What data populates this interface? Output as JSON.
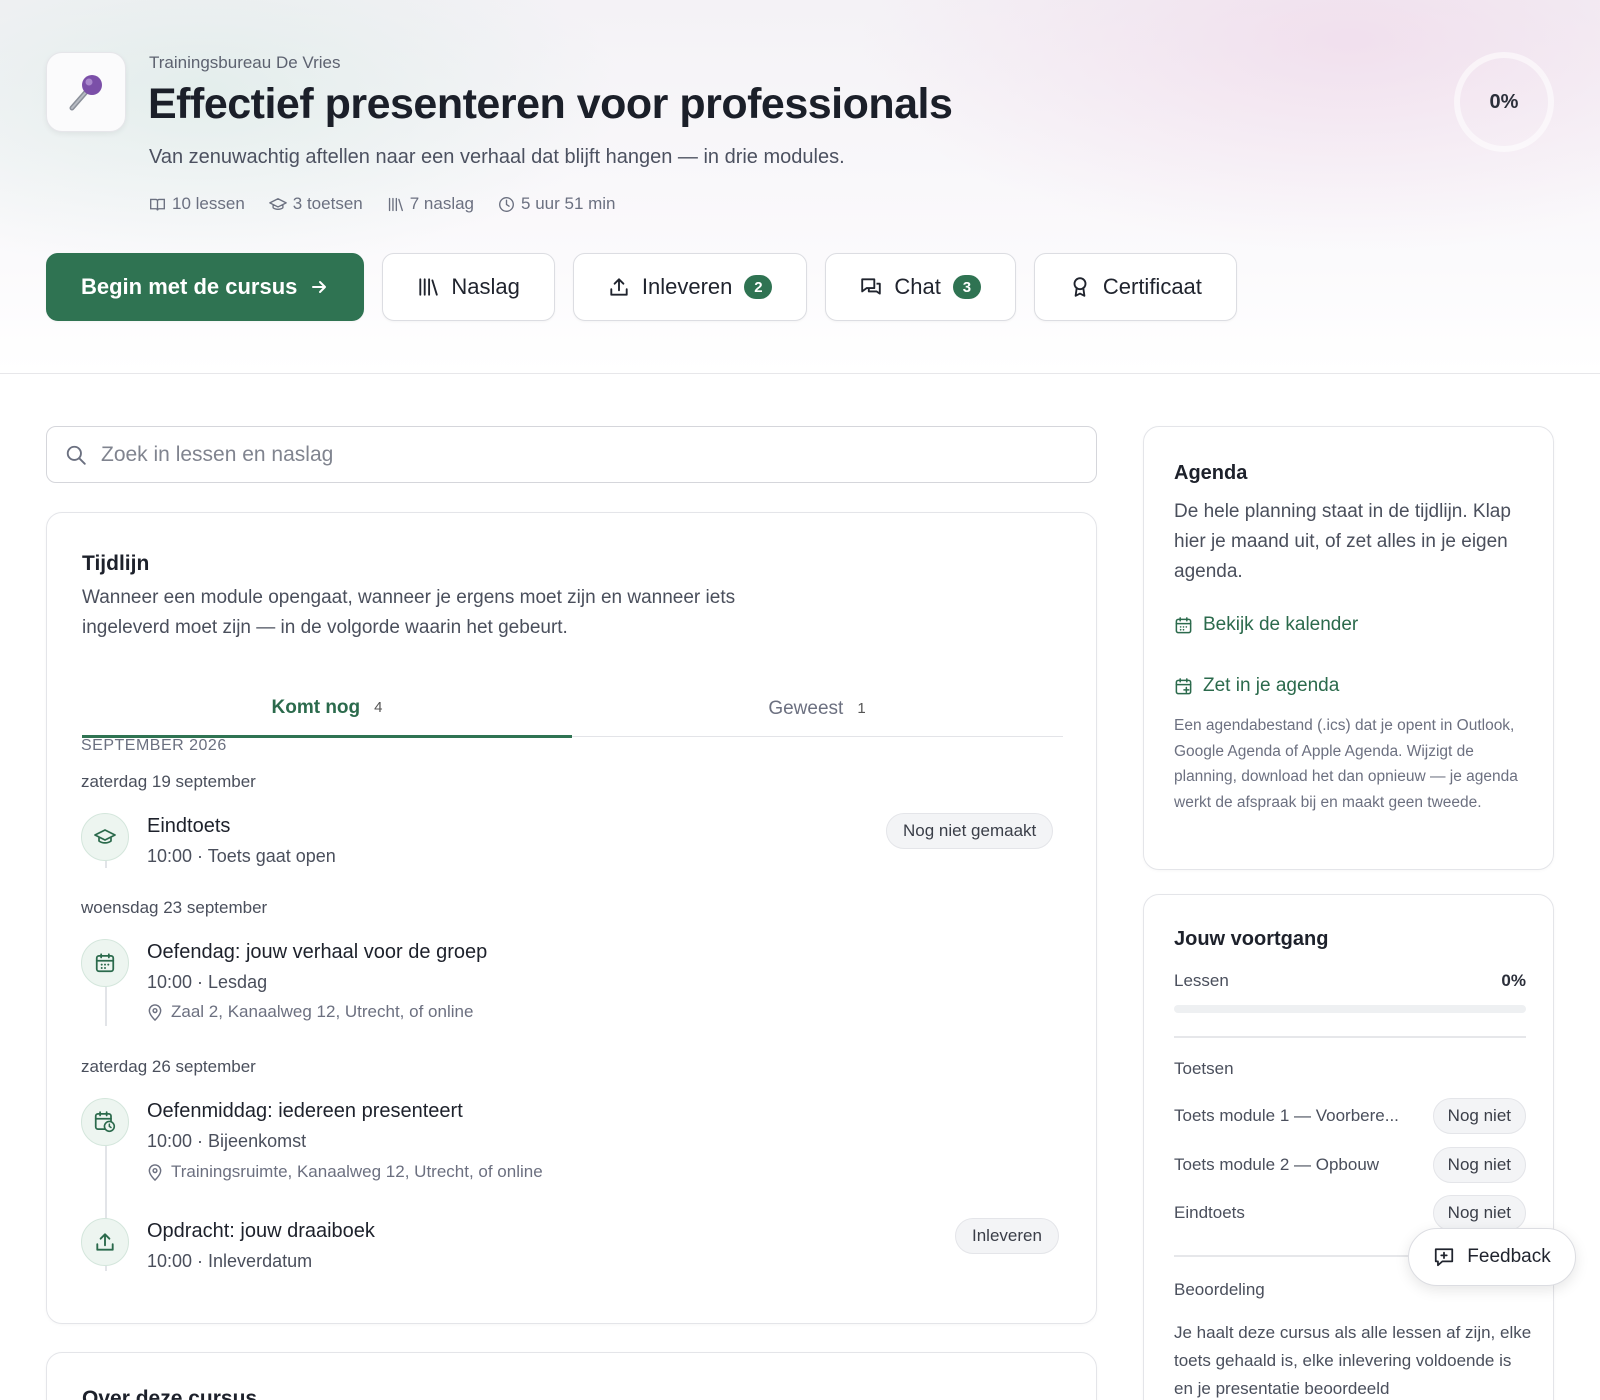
{
  "header": {
    "org": "Trainingsbureau De Vries",
    "title": "Effectief presenteren voor professionals",
    "subtitle": "Van zenuwachtig aftellen naar een verhaal dat blijft hangen — in drie modules.",
    "meta": {
      "lessons": "10 lessen",
      "tests": "3 toetsen",
      "reference": "7 naslag",
      "duration": "5 uur 51 min"
    },
    "progress": "0%",
    "progress_value": 0
  },
  "actions": {
    "start": "Begin met de cursus",
    "reference": "Naslag",
    "submit": "Inleveren",
    "submit_count": "2",
    "chat": "Chat",
    "chat_count": "3",
    "certificate": "Certificaat"
  },
  "search": {
    "placeholder": "Zoek in lessen en naslag"
  },
  "timeline": {
    "title": "Tijdlijn",
    "description": "Wanneer een module opengaat, wanneer je ergens moet zijn en wanneer iets ingeleverd moet zijn — in de volgorde waarin het gebeurt.",
    "tabs": [
      {
        "label": "Komt nog",
        "count": "4"
      },
      {
        "label": "Geweest",
        "count": "1"
      }
    ],
    "month": "SEPTEMBER 2026",
    "days": [
      {
        "label": "zaterdag 19 september",
        "events": [
          {
            "title": "Eindtoets",
            "meta": "10:00 · Toets gaat open",
            "pill": "Nog niet gemaakt"
          }
        ]
      },
      {
        "label": "woensdag 23 september",
        "events": [
          {
            "title": "Oefendag: jouw verhaal voor de groep",
            "meta": "10:00 · Lesdag",
            "location": "Zaal 2, Kanaalweg 12, Utrecht, of online"
          }
        ]
      },
      {
        "label": "zaterdag 26 september",
        "events": [
          {
            "title": "Oefenmiddag: iedereen presenteert",
            "meta": "10:00 · Bijeenkomst",
            "location": "Trainingsruimte, Kanaalweg 12, Utrecht, of online"
          },
          {
            "title": "Opdracht: jouw draaiboek",
            "meta": "10:00 · Inleverdatum",
            "pill": "Inleveren"
          }
        ]
      }
    ]
  },
  "about": {
    "title": "Over deze cursus"
  },
  "agenda": {
    "title": "Agenda",
    "description": "De hele planning staat in de tijdlijn. Klap hier je maand uit, of zet alles in je eigen agenda.",
    "calendar_link": "Bekijk de kalender",
    "ics_link": "Zet in je agenda",
    "note": "Een agendabestand (.ics) dat je opent in Outlook, Google Agenda of Apple Agenda. Wijzigt de planning, download het dan opnieuw — je agenda werkt de afspraak bij en maakt geen tweede."
  },
  "progress": {
    "title": "Jouw voortgang",
    "lessons_label": "Lessen",
    "lessons_value": "0%",
    "lessons_fraction": 0,
    "tests_title": "Toetsen",
    "tests": [
      {
        "name": "Toets module 1 — Voorbere...",
        "status": "Nog niet"
      },
      {
        "name": "Toets module 2 — Opbouw",
        "status": "Nog niet"
      },
      {
        "name": "Eindtoets",
        "status": "Nog niet"
      }
    ],
    "grading_title": "Beoordeling",
    "grading_text": "Je haalt deze cursus als alle lessen af zijn, elke toets gehaald is, elke inlevering voldoende is en je presentatie beoordeeld"
  },
  "feedback": {
    "label": "Feedback"
  },
  "colors": {
    "accent": "#2f7352",
    "accent_text": "#2b6a4c"
  }
}
